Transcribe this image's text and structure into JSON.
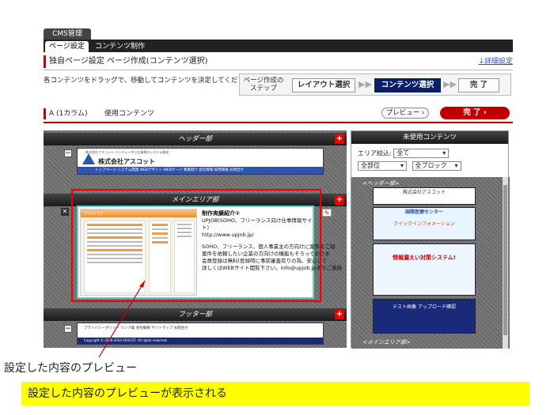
{
  "nav": {
    "cms_tab": "CMS管理",
    "tabs": [
      {
        "label": "ページ設定",
        "active": true
      },
      {
        "label": "コンテンツ制作",
        "active": false
      }
    ]
  },
  "page": {
    "title": "独自ページ設定  ページ作成(コンテンツ選択)",
    "detail_link": "↓詳細設定",
    "instruction": "各コンテンツをドラッグで、移動してコンテンツを決定してください。"
  },
  "steps": {
    "label": "ページ作成のステップ",
    "items": [
      "レイアウト選択",
      "コンテンツ選択",
      "完 了"
    ],
    "active_index": 1
  },
  "layout": {
    "column_label": "A (1カラム)",
    "usage_label": "使用コンテンツ",
    "preview_button": "プレビュー ›",
    "done_button": "完 了 ›"
  },
  "editor": {
    "header_section": "ヘッダー部",
    "main_section": "メインエリア部",
    "footer_section": "フッター部",
    "header_company": "株式会社アスコット",
    "header_nav": "トップページ  システム開発  WEBデザイン  WEBサーバ  事業紹介  会社情報  採用情報  お問合せ",
    "header_small": "株式会社アスコット  ベンチャー中小企業様のシステム開発",
    "mini_site_head": "アップジョブ",
    "main_text": {
      "title": "制作実績紹介①",
      "lines": [
        "UPJOB(SOHO、フリーランス向け仕事情報サイト)",
        "http://www.upjob.jp/",
        "",
        "SOHO、フリーランス、個人事業主の方向けに案件をご紹",
        "案件を依頼したい企業の方向けの機能もそろっておりま",
        "会員登録は無料(登録時に事前審査有りの為、安心して",
        "詳しくはWEBサイト閲覧下さい。info@upjob.jpまでご連絡"
      ]
    },
    "footer_links": "プライバシーポリシー   リンク集   会社概要   サイトマップ   お問合せ",
    "footer_copyright": "Copyright © 2009-2010 ASUCOT. All rights reserved."
  },
  "sidebar": {
    "title": "未使用コンテンツ",
    "area_filter_label": "エリア絞込:",
    "area_filter_value": "全て",
    "part_filter_value": "全部位",
    "block_filter_value": "全ブロック",
    "header_label": "<ヘッダー部>",
    "main_label": "<メインエリア部>",
    "thumbs": [
      "株式会社アスコット",
      "国際医療センター",
      "クイックインフォメーション",
      "情報漏えい対策システム!",
      "テスト画像 アップロード確認"
    ]
  },
  "annotation": {
    "caption": "設定した内容のプレビュー",
    "banner": "設定した内容のプレビューが表示される"
  }
}
